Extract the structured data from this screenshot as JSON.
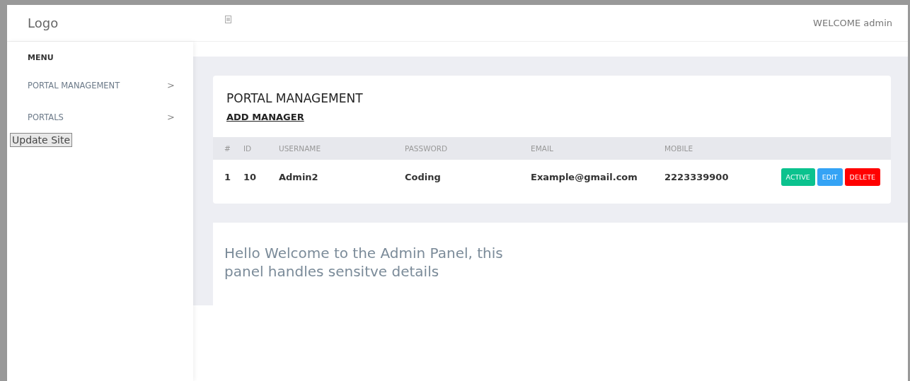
{
  "header": {
    "logo": "Logo",
    "welcome": "WELCOME admin"
  },
  "sidebar": {
    "heading": "MENU",
    "items": [
      {
        "label": "PORTAL MANAGEMENT",
        "chevron": ">"
      },
      {
        "label": "PORTALS",
        "chevron": ">"
      }
    ],
    "update_button": "Update Site"
  },
  "card": {
    "title": "PORTAL MANAGEMENT",
    "link": "ADD MANAGER",
    "table": {
      "columns": [
        "#",
        "ID",
        "USERNAME",
        "PASSWORD",
        "EMAIL",
        "MOBILE"
      ],
      "rows": [
        {
          "cells": [
            "1",
            "10",
            "Admin2",
            "Coding",
            "Example@gmail.com",
            "2223339900"
          ],
          "actions": [
            {
              "label": "ACTIVE",
              "kind": "active"
            },
            {
              "label": "EDIT",
              "kind": "edit"
            },
            {
              "label": "DELETE",
              "kind": "delete"
            }
          ]
        }
      ]
    }
  },
  "welcome_text": "Hello Welcome to the Admin Panel, this panel handles sensitve details"
}
